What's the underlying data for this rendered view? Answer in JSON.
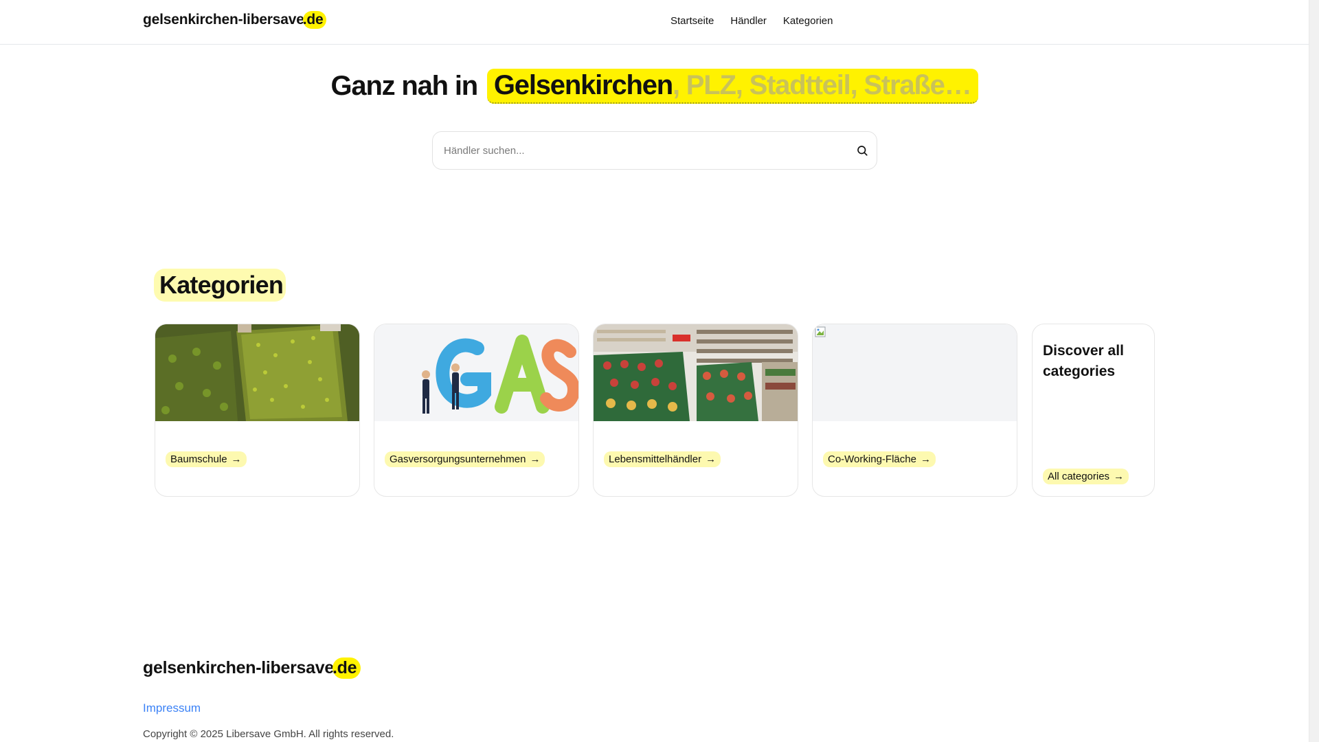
{
  "header": {
    "logo_main": "gelsenkirchen-libersav",
    "logo_e": "e",
    "logo_tld": ".de",
    "nav": [
      "Startseite",
      "Händler",
      "Kategorien"
    ]
  },
  "hero": {
    "prefix": "Ganz nah in",
    "city": "Gelsenkirchen",
    "suffix": ", PLZ, Stadtteil, Straße…"
  },
  "search": {
    "placeholder": "Händler suchen...",
    "value": ""
  },
  "categories": {
    "heading": "Kategorien",
    "items": [
      {
        "label": "Baumschule",
        "arrow": "→"
      },
      {
        "label": "Gasversorgungsunternehmen",
        "arrow": "→"
      },
      {
        "label": "Lebensmittelhändler",
        "arrow": "→"
      },
      {
        "label": "Co-Working-Fläche",
        "arrow": "→"
      }
    ],
    "all": {
      "title": "Discover all categories",
      "link": "All categories",
      "arrow": "→"
    }
  },
  "footer": {
    "logo_main": "gelsenkirchen-libersav",
    "logo_e": "e",
    "logo_tld": ".de",
    "impressum": "Impressum",
    "copyright": "Copyright © 2025 Libersave GmbH. All rights reserved."
  },
  "colors": {
    "accent": "#fff200",
    "pill": "#fdf9b0",
    "link": "#3b82f6"
  }
}
